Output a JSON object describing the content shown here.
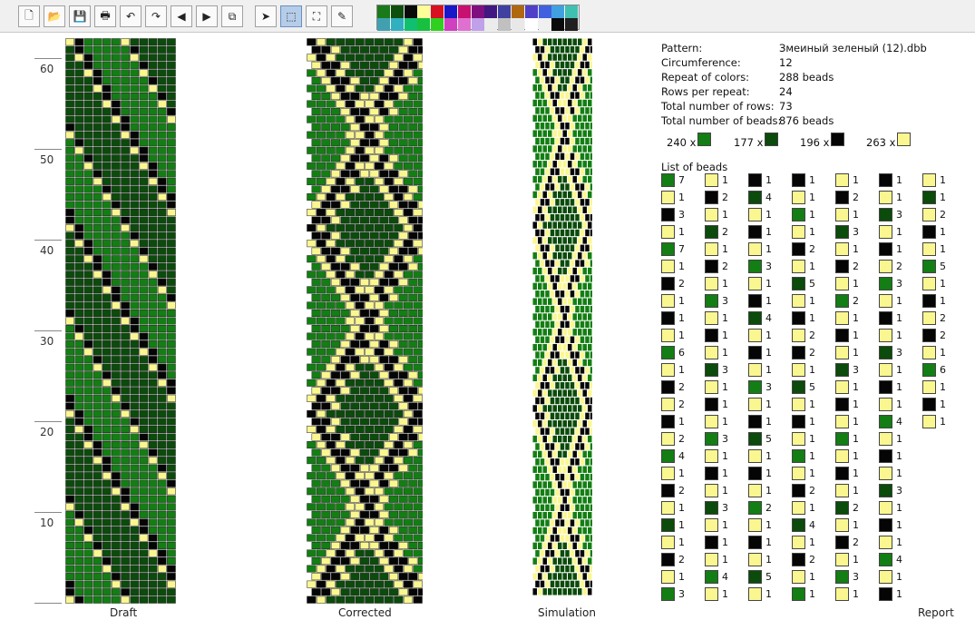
{
  "toolbar": {
    "buttons": [
      {
        "name": "new-file-button",
        "glyph": "🗋"
      },
      {
        "name": "open-button",
        "glyph": "📂"
      },
      {
        "name": "save-button",
        "glyph": "💾"
      },
      {
        "name": "print-button",
        "glyph": "🖶"
      },
      {
        "name": "undo-button",
        "glyph": "↶"
      },
      {
        "name": "redo-button",
        "glyph": "↷"
      },
      {
        "name": "scroll-left-button",
        "glyph": "◀"
      },
      {
        "name": "scroll-right-button",
        "glyph": "▶"
      },
      {
        "name": "copy-button",
        "glyph": "⧉"
      },
      {
        "name": "pointer-tool-button",
        "glyph": "➤"
      },
      {
        "name": "select-tool-button",
        "glyph": "⬚"
      },
      {
        "name": "fill-tool-button",
        "glyph": "⛶"
      },
      {
        "name": "eyedropper-tool-button",
        "glyph": "✎"
      }
    ],
    "palette_row1": [
      "#1a7a1a",
      "#0d4f0d",
      "#0a0a0a",
      "#fdfd99",
      "#d81020",
      "#1818c8",
      "#c81070",
      "#801080",
      "#401880",
      "#4040a0",
      "#b06810",
      "#5040c8",
      "#4060e0",
      "#40a0e0",
      "#40c0b0"
    ],
    "palette_row2": [
      "#40a0b0",
      "#30b0c0",
      "#10c070",
      "#18c040",
      "#30d020",
      "#d040c0",
      "#e070d0",
      "#c0a0e8",
      "#ececec",
      "#c0c0c0",
      "#e8e8e8",
      "#ffffff",
      "#f0f0f0",
      "#0a0a0a",
      "#202020"
    ]
  },
  "ruler": {
    "labels": [
      "60",
      "50",
      "40",
      "30",
      "20",
      "10"
    ]
  },
  "panels": {
    "draft": "Draft",
    "corrected": "Corrected",
    "simulation": "Simulation"
  },
  "pattern": {
    "cols": 12,
    "rows_per_repeat": 24,
    "rows_total": 73
  },
  "info": [
    {
      "label": "Pattern:",
      "value": "Змеиный зеленый (12).dbb"
    },
    {
      "label": "Circumference:",
      "value": "12"
    },
    {
      "label": "Repeat of colors:",
      "value": "288 beads"
    },
    {
      "label": "Rows per repeat:",
      "value": "24"
    },
    {
      "label": "Total number of rows:",
      "value": "73"
    },
    {
      "label": "Total number of beads:",
      "value": "876 beads"
    }
  ],
  "colors": {
    "G": "#137e13",
    "D": "#0b4b0b",
    "B": "#050505",
    "Y": "#fbf790"
  },
  "summary": [
    {
      "count": "240 x",
      "color": "G"
    },
    {
      "count": "177 x",
      "color": "D"
    },
    {
      "count": "196 x",
      "color": "B"
    },
    {
      "count": "263 x",
      "color": "Y"
    }
  ],
  "list_title": "List of beads",
  "bead_list": [
    [
      [
        "G",
        "7"
      ],
      [
        "Y",
        "1"
      ],
      [
        "B",
        "3"
      ],
      [
        "Y",
        "1"
      ],
      [
        "G",
        "7"
      ],
      [
        "Y",
        "1"
      ],
      [
        "B",
        "2"
      ],
      [
        "Y",
        "1"
      ],
      [
        "B",
        "1"
      ],
      [
        "Y",
        "1"
      ],
      [
        "G",
        "6"
      ],
      [
        "Y",
        "1"
      ],
      [
        "B",
        "2"
      ],
      [
        "Y",
        "2"
      ],
      [
        "B",
        "1"
      ],
      [
        "Y",
        "2"
      ],
      [
        "G",
        "4"
      ],
      [
        "Y",
        "1"
      ],
      [
        "B",
        "2"
      ],
      [
        "Y",
        "1"
      ],
      [
        "D",
        "1"
      ],
      [
        "Y",
        "1"
      ],
      [
        "B",
        "2"
      ],
      [
        "Y",
        "1"
      ],
      [
        "G",
        "3"
      ]
    ],
    [
      [
        "Y",
        "1"
      ],
      [
        "B",
        "2"
      ],
      [
        "Y",
        "1"
      ],
      [
        "D",
        "2"
      ],
      [
        "Y",
        "1"
      ],
      [
        "B",
        "2"
      ],
      [
        "Y",
        "1"
      ],
      [
        "G",
        "3"
      ],
      [
        "Y",
        "1"
      ],
      [
        "B",
        "1"
      ],
      [
        "Y",
        "1"
      ],
      [
        "D",
        "3"
      ],
      [
        "Y",
        "1"
      ],
      [
        "B",
        "1"
      ],
      [
        "Y",
        "1"
      ],
      [
        "G",
        "3"
      ],
      [
        "Y",
        "1"
      ],
      [
        "B",
        "1"
      ],
      [
        "Y",
        "1"
      ],
      [
        "D",
        "3"
      ],
      [
        "Y",
        "1"
      ],
      [
        "B",
        "1"
      ],
      [
        "Y",
        "1"
      ],
      [
        "G",
        "4"
      ],
      [
        "Y",
        "1"
      ]
    ],
    [
      [
        "B",
        "1"
      ],
      [
        "D",
        "4"
      ],
      [
        "Y",
        "1"
      ],
      [
        "B",
        "1"
      ],
      [
        "Y",
        "1"
      ],
      [
        "G",
        "3"
      ],
      [
        "Y",
        "1"
      ],
      [
        "B",
        "1"
      ],
      [
        "D",
        "4"
      ],
      [
        "Y",
        "1"
      ],
      [
        "B",
        "1"
      ],
      [
        "Y",
        "1"
      ],
      [
        "G",
        "3"
      ],
      [
        "Y",
        "1"
      ],
      [
        "B",
        "1"
      ],
      [
        "D",
        "5"
      ],
      [
        "Y",
        "1"
      ],
      [
        "B",
        "1"
      ],
      [
        "Y",
        "1"
      ],
      [
        "G",
        "2"
      ],
      [
        "Y",
        "1"
      ],
      [
        "B",
        "1"
      ],
      [
        "Y",
        "1"
      ],
      [
        "D",
        "5"
      ],
      [
        "Y",
        "1"
      ]
    ],
    [
      [
        "B",
        "1"
      ],
      [
        "Y",
        "1"
      ],
      [
        "G",
        "1"
      ],
      [
        "Y",
        "1"
      ],
      [
        "B",
        "2"
      ],
      [
        "Y",
        "1"
      ],
      [
        "D",
        "5"
      ],
      [
        "Y",
        "1"
      ],
      [
        "B",
        "1"
      ],
      [
        "Y",
        "2"
      ],
      [
        "B",
        "2"
      ],
      [
        "Y",
        "1"
      ],
      [
        "D",
        "5"
      ],
      [
        "Y",
        "1"
      ],
      [
        "B",
        "1"
      ],
      [
        "Y",
        "1"
      ],
      [
        "G",
        "1"
      ],
      [
        "Y",
        "1"
      ],
      [
        "B",
        "2"
      ],
      [
        "Y",
        "1"
      ],
      [
        "D",
        "4"
      ],
      [
        "Y",
        "1"
      ],
      [
        "B",
        "2"
      ],
      [
        "Y",
        "1"
      ],
      [
        "G",
        "1"
      ]
    ],
    [
      [
        "Y",
        "1"
      ],
      [
        "B",
        "2"
      ],
      [
        "Y",
        "1"
      ],
      [
        "D",
        "3"
      ],
      [
        "Y",
        "1"
      ],
      [
        "B",
        "2"
      ],
      [
        "Y",
        "1"
      ],
      [
        "G",
        "2"
      ],
      [
        "Y",
        "1"
      ],
      [
        "B",
        "1"
      ],
      [
        "Y",
        "1"
      ],
      [
        "D",
        "3"
      ],
      [
        "Y",
        "1"
      ],
      [
        "B",
        "1"
      ],
      [
        "Y",
        "1"
      ],
      [
        "G",
        "1"
      ],
      [
        "Y",
        "1"
      ],
      [
        "B",
        "1"
      ],
      [
        "Y",
        "1"
      ],
      [
        "D",
        "2"
      ],
      [
        "Y",
        "1"
      ],
      [
        "B",
        "2"
      ],
      [
        "Y",
        "1"
      ],
      [
        "G",
        "3"
      ],
      [
        "Y",
        "1"
      ]
    ],
    [
      [
        "B",
        "1"
      ],
      [
        "Y",
        "1"
      ],
      [
        "D",
        "3"
      ],
      [
        "Y",
        "1"
      ],
      [
        "B",
        "1"
      ],
      [
        "Y",
        "2"
      ],
      [
        "G",
        "3"
      ],
      [
        "Y",
        "1"
      ],
      [
        "B",
        "1"
      ],
      [
        "Y",
        "1"
      ],
      [
        "D",
        "3"
      ],
      [
        "Y",
        "1"
      ],
      [
        "B",
        "1"
      ],
      [
        "Y",
        "1"
      ],
      [
        "G",
        "4"
      ],
      [
        "Y",
        "1"
      ],
      [
        "B",
        "1"
      ],
      [
        "Y",
        "1"
      ],
      [
        "D",
        "3"
      ],
      [
        "Y",
        "1"
      ],
      [
        "B",
        "1"
      ],
      [
        "Y",
        "1"
      ],
      [
        "G",
        "4"
      ],
      [
        "Y",
        "1"
      ],
      [
        "B",
        "1"
      ]
    ],
    [
      [
        "Y",
        "1"
      ],
      [
        "D",
        "1"
      ],
      [
        "Y",
        "2"
      ],
      [
        "B",
        "1"
      ],
      [
        "Y",
        "1"
      ],
      [
        "G",
        "5"
      ],
      [
        "Y",
        "1"
      ],
      [
        "B",
        "1"
      ],
      [
        "Y",
        "2"
      ],
      [
        "B",
        "2"
      ],
      [
        "Y",
        "1"
      ],
      [
        "G",
        "6"
      ],
      [
        "Y",
        "1"
      ],
      [
        "B",
        "1"
      ],
      [
        "Y",
        "1"
      ]
    ]
  ],
  "report_label": "Report"
}
